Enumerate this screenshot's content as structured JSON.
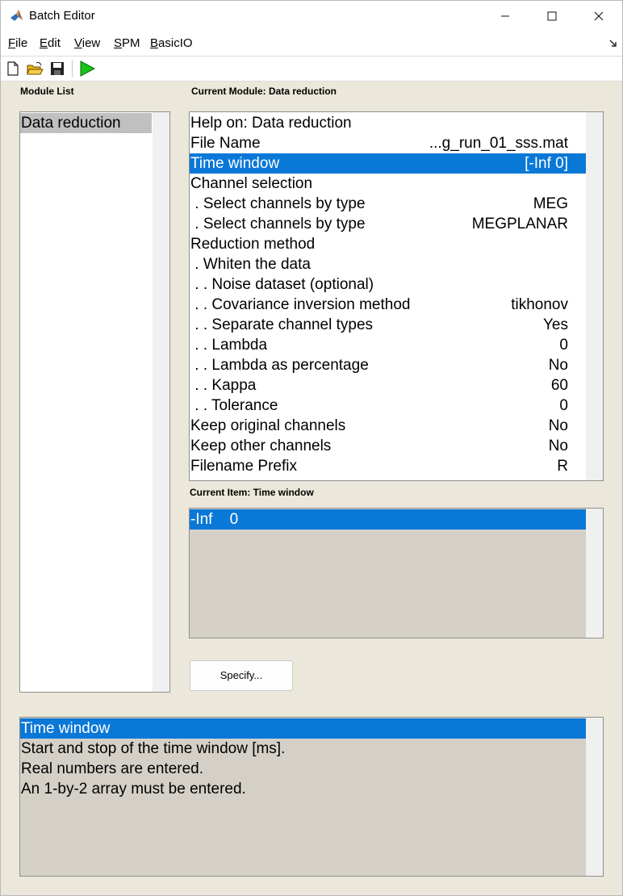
{
  "window": {
    "title": "Batch Editor",
    "minimize": "—",
    "maximize": "☐",
    "close": "✕"
  },
  "menu": {
    "items": [
      {
        "label": "File",
        "accel": "F",
        "rest": "ile"
      },
      {
        "label": "Edit",
        "accel": "E",
        "rest": "dit"
      },
      {
        "label": "View",
        "accel": "V",
        "rest": "iew"
      },
      {
        "label": "SPM",
        "accel": "S",
        "rest": "PM"
      },
      {
        "label": "BasicIO",
        "accel": "B",
        "rest": "asicIO"
      }
    ],
    "overflow_icon": "dock-arrow-icon"
  },
  "toolbar": {
    "buttons": [
      "new-file-icon",
      "open-folder-icon",
      "save-icon",
      "run-icon"
    ],
    "colors": {
      "run": "#18c418",
      "folder": "#e8b220"
    }
  },
  "module_list": {
    "label": "Module List",
    "items": [
      "Data reduction"
    ]
  },
  "current_module": {
    "label": "Current Module: Data reduction",
    "rows": [
      {
        "label": "Help on: Data reduction",
        "value": ""
      },
      {
        "label": "File Name",
        "value": "...g_run_01_sss.mat"
      },
      {
        "label": "Time window",
        "value": "[-Inf 0]",
        "selected": true
      },
      {
        "label": "Channel selection",
        "value": ""
      },
      {
        "label": " . Select channels by type",
        "value": "MEG"
      },
      {
        "label": " . Select channels by type",
        "value": "MEGPLANAR"
      },
      {
        "label": "Reduction method",
        "value": ""
      },
      {
        "label": " . Whiten the data",
        "value": ""
      },
      {
        "label": " . . Noise dataset (optional)",
        "value": ""
      },
      {
        "label": " . . Covariance inversion method",
        "value": "tikhonov"
      },
      {
        "label": " . . Separate channel types",
        "value": "Yes"
      },
      {
        "label": " . . Lambda",
        "value": "0"
      },
      {
        "label": " . . Lambda as percentage",
        "value": "No"
      },
      {
        "label": " . . Kappa",
        "value": "60"
      },
      {
        "label": " . . Tolerance",
        "value": "0"
      },
      {
        "label": "Keep original channels",
        "value": "No"
      },
      {
        "label": "Keep other channels",
        "value": "No"
      },
      {
        "label": "Filename Prefix",
        "value": "R"
      }
    ]
  },
  "current_item": {
    "label": "Current Item: Time window",
    "value_text": "-Inf    0"
  },
  "specify_button": "Specify...",
  "help": {
    "lines": [
      "Time window",
      "Start and stop of the time window [ms].",
      "Real numbers are entered.",
      "An 1-by-2 array must be entered."
    ]
  },
  "colors": {
    "selection": "#0a78d7",
    "panel_bg": "#ebe7da",
    "gray_list": "#d4d0c8"
  }
}
